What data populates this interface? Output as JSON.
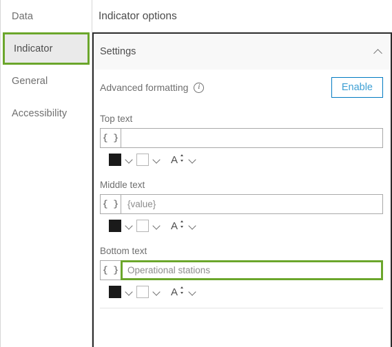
{
  "sidebar": {
    "items": [
      {
        "label": "Data",
        "selected": false
      },
      {
        "label": "Indicator",
        "selected": true
      },
      {
        "label": "General",
        "selected": false
      },
      {
        "label": "Accessibility",
        "selected": false
      }
    ]
  },
  "panel": {
    "title": "Indicator options",
    "settings": {
      "title": "Settings",
      "collapse_icon": "chevron-up-icon",
      "advanced_formatting": {
        "label": "Advanced formatting",
        "info_icon": "info-icon",
        "info_glyph": "i",
        "enable_label": "Enable"
      },
      "fields": [
        {
          "label": "Top text",
          "brace": "{ }",
          "value": "",
          "placeholder": "",
          "highlighted": false,
          "format": {
            "text_color": "#1a1a1a",
            "background_color": "#ffffff",
            "font_size_icon": "font-size-icon",
            "font_size_glyph": "A"
          }
        },
        {
          "label": "Middle text",
          "brace": "{ }",
          "value": "{value}",
          "placeholder": "",
          "highlighted": false,
          "format": {
            "text_color": "#1a1a1a",
            "background_color": "#ffffff",
            "font_size_icon": "font-size-icon",
            "font_size_glyph": "A"
          }
        },
        {
          "label": "Bottom text",
          "brace": "{ }",
          "value": "Operational stations",
          "placeholder": "",
          "highlighted": true,
          "format": {
            "text_color": "#1a1a1a",
            "background_color": "#ffffff",
            "font_size_icon": "font-size-icon",
            "font_size_glyph": "A"
          }
        }
      ]
    }
  },
  "colors": {
    "highlight_green": "#6ba62b",
    "link_blue": "#0079c1",
    "enable_text_blue": "#3d9fd4",
    "selected_bg": "#eaeaea",
    "card_head_bg": "#f8f8f8"
  }
}
